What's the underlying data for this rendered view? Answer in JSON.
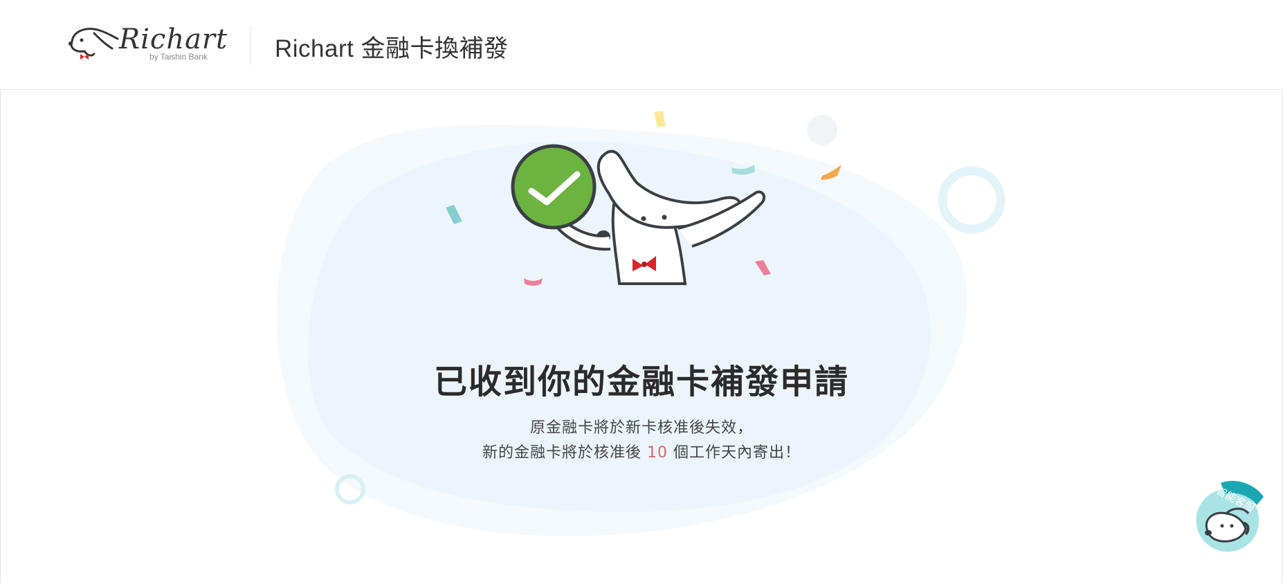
{
  "header": {
    "logo_text": "Richart",
    "logo_sub": "by Taishin Bank",
    "title": "Richart 金融卡換補發"
  },
  "result": {
    "headline": "已收到你的金融卡補發申請",
    "line1": "原金融卡將於新卡核准後失效，",
    "line2_prefix": "新的金融卡將於核准後 ",
    "line2_days": "10",
    "line2_suffix": " 個工作天內寄出！"
  },
  "chatbot": {
    "label": "智能客服"
  },
  "colors": {
    "accent_green": "#6cb33f",
    "highlight_red": "#e0606d",
    "blob_blue": "#eef6fc",
    "teal": "#7ccfd4"
  }
}
